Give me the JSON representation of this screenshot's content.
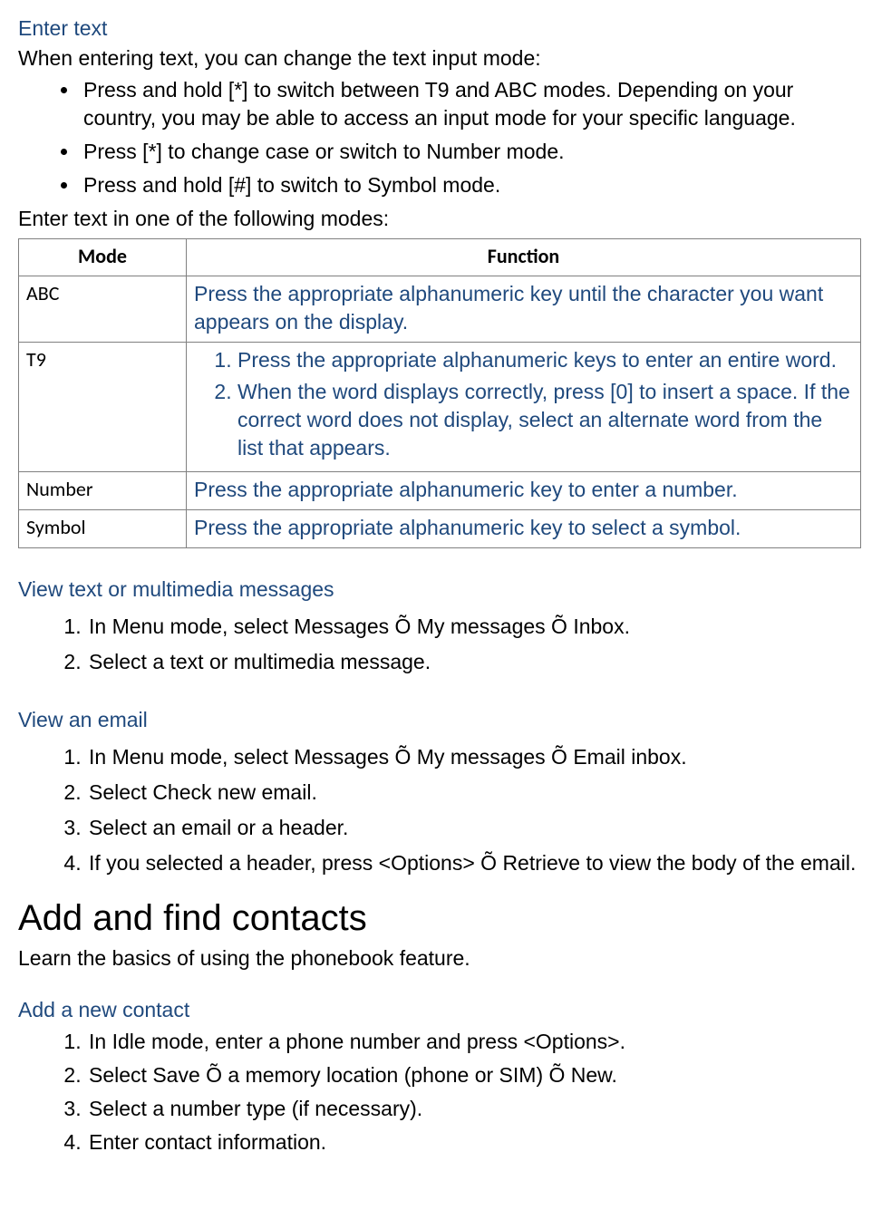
{
  "section_enter": {
    "title": "Enter text",
    "intro": "When entering text, you can change the text input mode:",
    "bullets": [
      "Press and hold [*] to switch between T9 and ABC modes. Depending on your country, you may be able to access an input mode for your specific language.",
      "Press [*] to change case or switch to Number mode.",
      "Press and hold [#] to switch to Symbol mode."
    ],
    "post": "Enter text in one of the following modes:"
  },
  "table": {
    "head": {
      "mode": "Mode",
      "func": "Function"
    },
    "rows": {
      "abc": {
        "mode": "ABC",
        "func": "Press the appropriate alphanumeric key until the character you want appears on the display."
      },
      "t9": {
        "mode": "T9",
        "steps": [
          "Press the appropriate alphanumeric keys to enter an entire word.",
          "When the word displays correctly, press [0] to insert a space. If the correct word does not display, select an alternate word from the list that appears."
        ]
      },
      "number": {
        "mode": "Number",
        "func": "Press the appropriate alphanumeric key to enter a number."
      },
      "symbol": {
        "mode": "Symbol",
        "func": "Press the appropriate alphanumeric key to select a symbol."
      }
    }
  },
  "section_view_msg": {
    "title": "View text or multimedia messages",
    "steps": [
      "In Menu mode, select Messages Õ My messages Õ Inbox.",
      "Select a text or multimedia message."
    ]
  },
  "section_view_email": {
    "title": "View an email",
    "steps": [
      "In Menu mode, select Messages Õ My messages Õ Email inbox.",
      "Select Check new email.",
      "Select an email or a header.",
      "If you selected a header, press <Options> Õ Retrieve to view the body of the email."
    ]
  },
  "section_contacts": {
    "title": "Add and find contacts",
    "intro": "Learn the basics of using the phonebook feature."
  },
  "section_add_contact": {
    "title": "Add a new contact",
    "steps": [
      "In Idle mode, enter a phone number and press <Options>.",
      "Select Save Õ a memory location (phone or SIM) Õ New.",
      "Select a number type (if necessary).",
      "Enter contact information."
    ]
  }
}
